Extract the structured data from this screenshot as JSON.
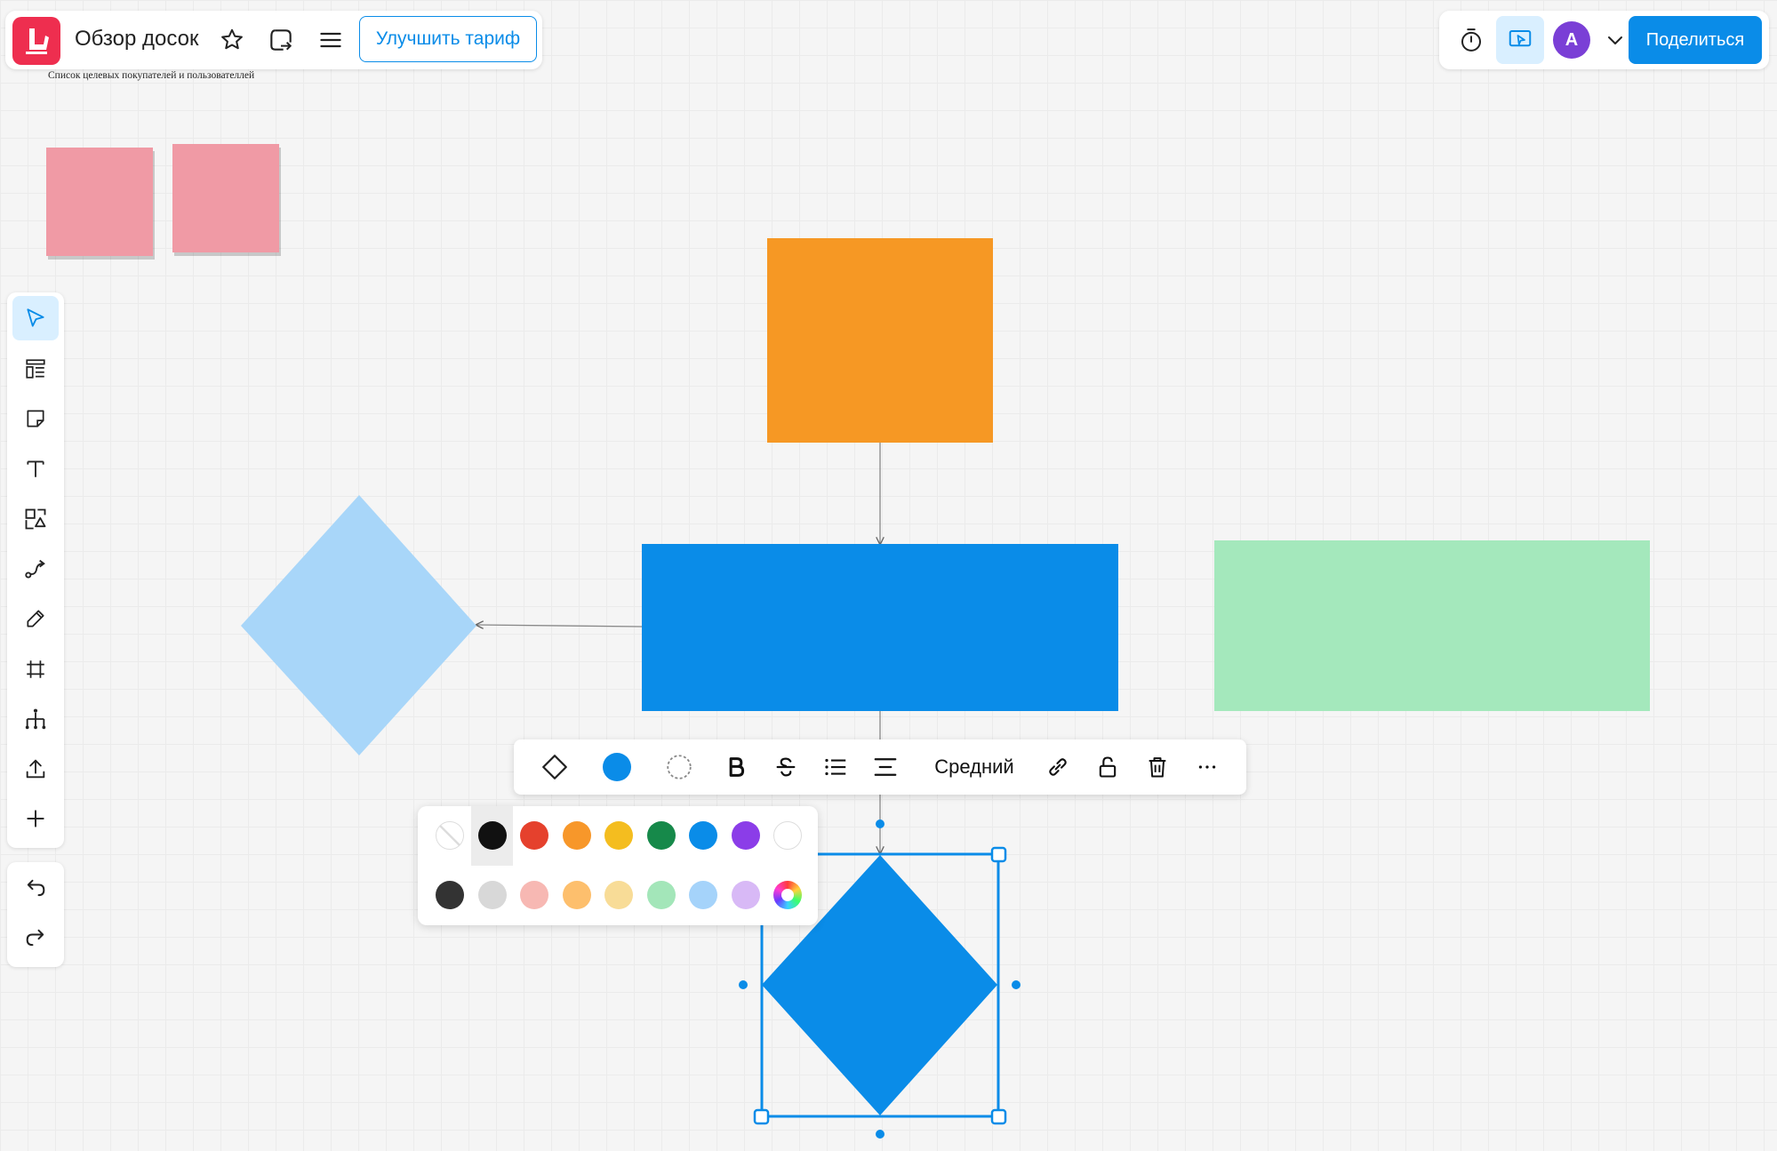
{
  "header": {
    "board_title": "Обзор досок",
    "upgrade_label": "Улучшить тариф",
    "subtitle": "Список целевых покупателей и пользователлей",
    "icons": [
      "star-icon",
      "board-switch-icon",
      "menu-icon"
    ]
  },
  "top_right": {
    "share_label": "Поделиться",
    "avatar_letter": "A",
    "icons": [
      "timer-icon",
      "presentation-icon",
      "chevron-down-icon"
    ]
  },
  "toolbar": {
    "tools": [
      "select",
      "templates",
      "sticky-note",
      "text",
      "shapes",
      "connector",
      "pen",
      "frame",
      "mind-map",
      "upload",
      "add"
    ],
    "active_tool": "select",
    "history": [
      "undo",
      "redo"
    ]
  },
  "format_bar": {
    "font_size_label": "Средний",
    "fill_color": "#0a8ce8",
    "items": [
      "shape-type",
      "fill-color",
      "border-style",
      "bold",
      "strikethrough",
      "list",
      "align",
      "font-size",
      "link",
      "lock",
      "delete",
      "more"
    ]
  },
  "palette": {
    "row1": [
      "none",
      "#111111",
      "#e5412d",
      "#f7972a",
      "#f4bd1f",
      "#16894a",
      "#0a8ce8",
      "#8b3de8",
      "#ffffff"
    ],
    "row2": [
      "#333333",
      "#d8d8d8",
      "#f7b8b3",
      "#fdbf6d",
      "#f8dc97",
      "#a3e6b9",
      "#a5d3fa",
      "#d8b9f6",
      "custom-gradient"
    ],
    "selected": "#111111"
  },
  "canvas": {
    "colors": {
      "sticky": "#f09aa5",
      "orange_rect": "#f69824",
      "blue_rect": "#0a8ce8",
      "light_blue_diamond": "#a8d6f9",
      "green_rect": "#a4e8bc",
      "selected_diamond": "#0a8ce8",
      "selection": "#0a8ce8"
    }
  }
}
